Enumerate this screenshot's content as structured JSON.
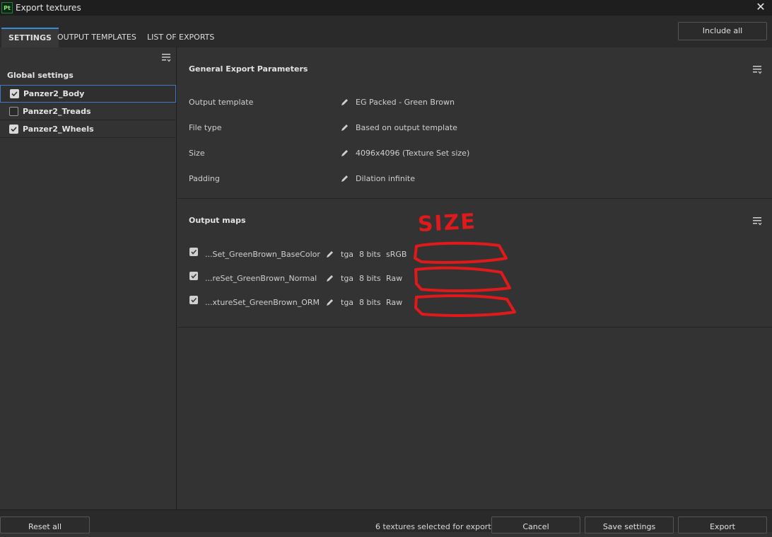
{
  "window": {
    "title": "Export textures",
    "app_icon": "Pt"
  },
  "tabs": [
    {
      "label": "SETTINGS",
      "active": true
    },
    {
      "label": "OUTPUT TEMPLATES",
      "active": false
    },
    {
      "label": "LIST OF EXPORTS",
      "active": false
    }
  ],
  "header": {
    "include_all_label": "Include all"
  },
  "sidebar": {
    "global_settings_label": "Global settings",
    "texture_sets": [
      {
        "label": "Panzer2_Body",
        "checked": true,
        "selected": true
      },
      {
        "label": "Panzer2_Treads",
        "checked": false,
        "selected": false
      },
      {
        "label": "Panzer2_Wheels",
        "checked": true,
        "selected": false
      }
    ]
  },
  "general_params": {
    "title": "General Export Parameters",
    "rows": [
      {
        "label": "Output template",
        "value": "EG Packed - Green Brown"
      },
      {
        "label": "File type",
        "value": "Based on output template"
      },
      {
        "label": "Size",
        "value": "4096x4096 (Texture Set size)"
      },
      {
        "label": "Padding",
        "value": "Dilation infinite"
      }
    ]
  },
  "output_maps": {
    "title": "Output maps",
    "maps": [
      {
        "name": "...Set_GreenBrown_BaseColor",
        "format": "tga",
        "bits": "8 bits",
        "colorspace": "sRGB",
        "checked": true
      },
      {
        "name": "...reSet_GreenBrown_Normal",
        "format": "tga",
        "bits": "8 bits",
        "colorspace": "Raw",
        "checked": true
      },
      {
        "name": "...xtureSet_GreenBrown_ORM",
        "format": "tga",
        "bits": "8 bits",
        "colorspace": "Raw",
        "checked": true
      }
    ]
  },
  "annotation": {
    "text": "SIZE",
    "color": "#e01a1a"
  },
  "footer": {
    "reset_label": "Reset all",
    "status": "6 textures selected for export",
    "cancel_label": "Cancel",
    "save_label": "Save settings",
    "export_label": "Export"
  },
  "colors": {
    "accent": "#3a8bd6",
    "background": "#333333"
  }
}
